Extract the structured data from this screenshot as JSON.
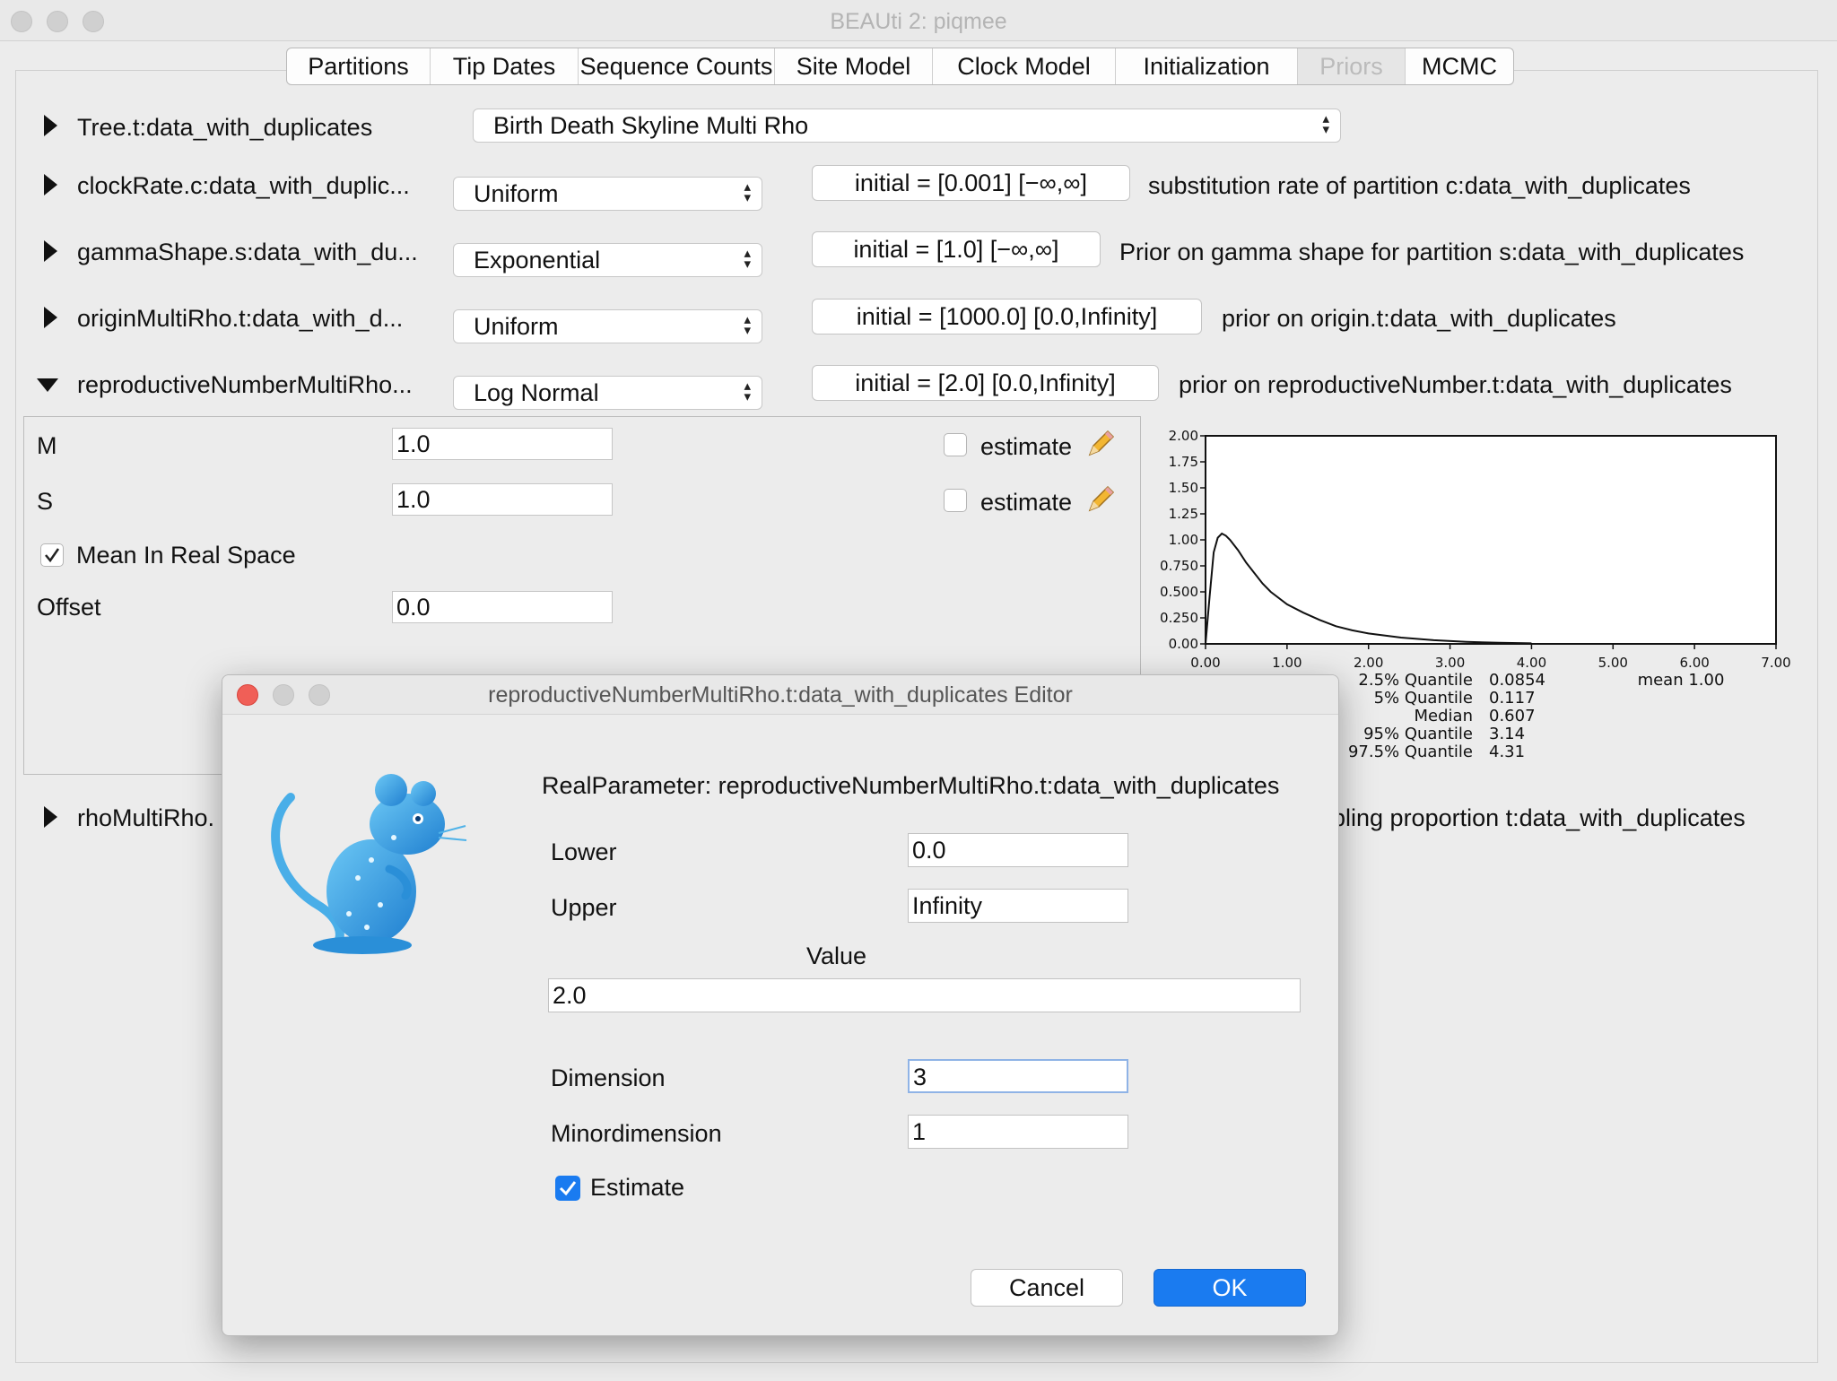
{
  "window": {
    "title": "BEAUti 2: piqmee"
  },
  "tabs": [
    "Partitions",
    "Tip Dates",
    "Sequence Counts",
    "Site Model",
    "Clock Model",
    "Initialization",
    "Priors",
    "MCMC"
  ],
  "tree_row": {
    "label": "Tree.t:data_with_duplicates",
    "value": "Birth Death Skyline Multi Rho"
  },
  "priors": [
    {
      "label": "clockRate.c:data_with_duplic...",
      "dist": "Uniform",
      "initial": "initial = [0.001] [−∞,∞]",
      "desc": "substitution rate of partition c:data_with_duplicates"
    },
    {
      "label": "gammaShape.s:data_with_du...",
      "dist": "Exponential",
      "initial": "initial = [1.0] [−∞,∞]",
      "desc": "Prior on gamma shape for partition s:data_with_duplicates"
    },
    {
      "label": "originMultiRho.t:data_with_d...",
      "dist": "Uniform",
      "initial": "initial = [1000.0] [0.0,Infinity]",
      "desc": "prior on origin.t:data_with_duplicates"
    },
    {
      "label": "reproductiveNumberMultiRho...",
      "dist": "Log Normal",
      "initial": "initial = [2.0] [0.0,Infinity]",
      "desc": "prior on reproductiveNumber.t:data_with_duplicates"
    }
  ],
  "panel": {
    "m_label": "M",
    "m_value": "1.0",
    "s_label": "S",
    "s_value": "1.0",
    "estimate_label": "estimate",
    "mean_real_label": "Mean In Real Space",
    "offset_label": "Offset",
    "offset_value": "0.0"
  },
  "rho_row": {
    "label": "rhoMultiRho.",
    "desc": "pling proportion t:data_with_duplicates"
  },
  "chart_data": {
    "type": "line",
    "x": [
      0.0,
      0.05,
      0.1,
      0.15,
      0.2,
      0.25,
      0.3,
      0.4,
      0.5,
      0.6,
      0.7,
      0.8,
      1.0,
      1.2,
      1.4,
      1.6,
      1.8,
      2.0,
      2.4,
      2.8,
      3.2,
      3.6,
      4.0
    ],
    "y": [
      0.0,
      0.45,
      0.88,
      1.02,
      1.06,
      1.04,
      1.0,
      0.9,
      0.78,
      0.68,
      0.58,
      0.5,
      0.38,
      0.3,
      0.23,
      0.17,
      0.13,
      0.1,
      0.06,
      0.035,
      0.02,
      0.01,
      0.005
    ],
    "xlim": [
      0,
      7
    ],
    "ylim": [
      0,
      2
    ],
    "xticks": [
      "0.00",
      "1.00",
      "2.00",
      "3.00",
      "4.00",
      "5.00",
      "6.00",
      "7.00"
    ],
    "yticks": [
      "0.00",
      "0.250",
      "0.500",
      "0.750",
      "1.00",
      "1.25",
      "1.50",
      "1.75",
      "2.00"
    ],
    "quantiles": [
      {
        "label": "2.5% Quantile",
        "value": "0.0854"
      },
      {
        "label": "5% Quantile",
        "value": "0.117"
      },
      {
        "label": "Median",
        "value": "0.607"
      },
      {
        "label": "95% Quantile",
        "value": "3.14"
      },
      {
        "label": "97.5% Quantile",
        "value": "4.31"
      }
    ],
    "mean": "mean 1.00"
  },
  "dialog": {
    "title": "reproductiveNumberMultiRho.t:data_with_duplicates Editor",
    "heading": "RealParameter: reproductiveNumberMultiRho.t:data_with_duplicates",
    "lower_label": "Lower",
    "lower_value": "0.0",
    "upper_label": "Upper",
    "upper_value": "Infinity",
    "value_label": "Value",
    "value_value": "2.0",
    "dimension_label": "Dimension",
    "dimension_value": "3",
    "minordim_label": "Minordimension",
    "minordim_value": "1",
    "estimate_label": "Estimate",
    "cancel": "Cancel",
    "ok": "OK"
  },
  "colors": {
    "accent": "#1a7bf0",
    "mouse": "#3aa6e8",
    "close": "#f05f57"
  }
}
